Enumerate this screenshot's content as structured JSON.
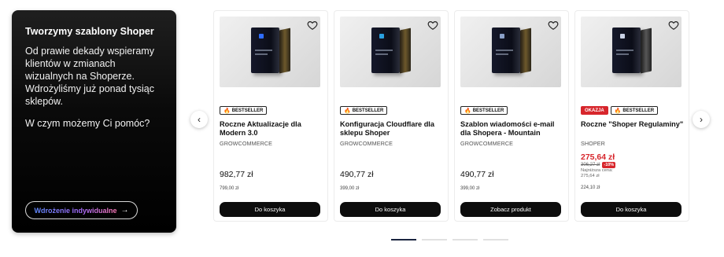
{
  "promo": {
    "title": "Tworzymy szablony Shoper",
    "text": "Od prawie dekady wspieramy klientów w zmianach wizualnych na Shoperze. Wdrożyliśmy już ponad tysiąc sklepów.",
    "question": "W czym możemy Ci pomóc?",
    "button_label": "Wdrożenie indywidualne",
    "button_arrow": "→"
  },
  "nav": {
    "prev": "‹",
    "next": "›"
  },
  "products": [
    {
      "badges": [
        "BESTSELLER"
      ],
      "name": "Roczne Aktualizacje dla Modern 3.0",
      "brand": "GROWCOMMERCE",
      "price": "982,77 zł",
      "net": "799,00 zł",
      "button": "Do koszyka"
    },
    {
      "badges": [
        "BESTSELLER"
      ],
      "name": "Konfiguracja Cloudflare dla sklepu Shoper",
      "brand": "GROWCOMMERCE",
      "price": "490,77 zł",
      "net": "399,00 zł",
      "button": "Do koszyka"
    },
    {
      "badges": [
        "BESTSELLER"
      ],
      "name": "Szablon wiadomości e-mail dla Shopera - Mountain",
      "brand": "GROWCOMMERCE",
      "price": "490,77 zł",
      "net": "399,00 zł",
      "button": "Zobacz produkt"
    },
    {
      "badges": [
        "OKAZJA",
        "BESTSELLER"
      ],
      "name": "Roczne \"Shoper Regulaminy\"",
      "brand": "SHOPER",
      "sale_price": "275,64 zł",
      "old_price": "306,27 zł",
      "discount": "-10%",
      "lowest_label": "Najniższa cena:",
      "lowest_value": "275,64 zł",
      "net": "224,10 zł",
      "button": "Do koszyka"
    }
  ],
  "pagination": {
    "pages": 4,
    "active": 1
  },
  "colors": {
    "accent": "#d7262c",
    "button_bg": "#0d0d0d",
    "pager_active": "#1a2440"
  }
}
